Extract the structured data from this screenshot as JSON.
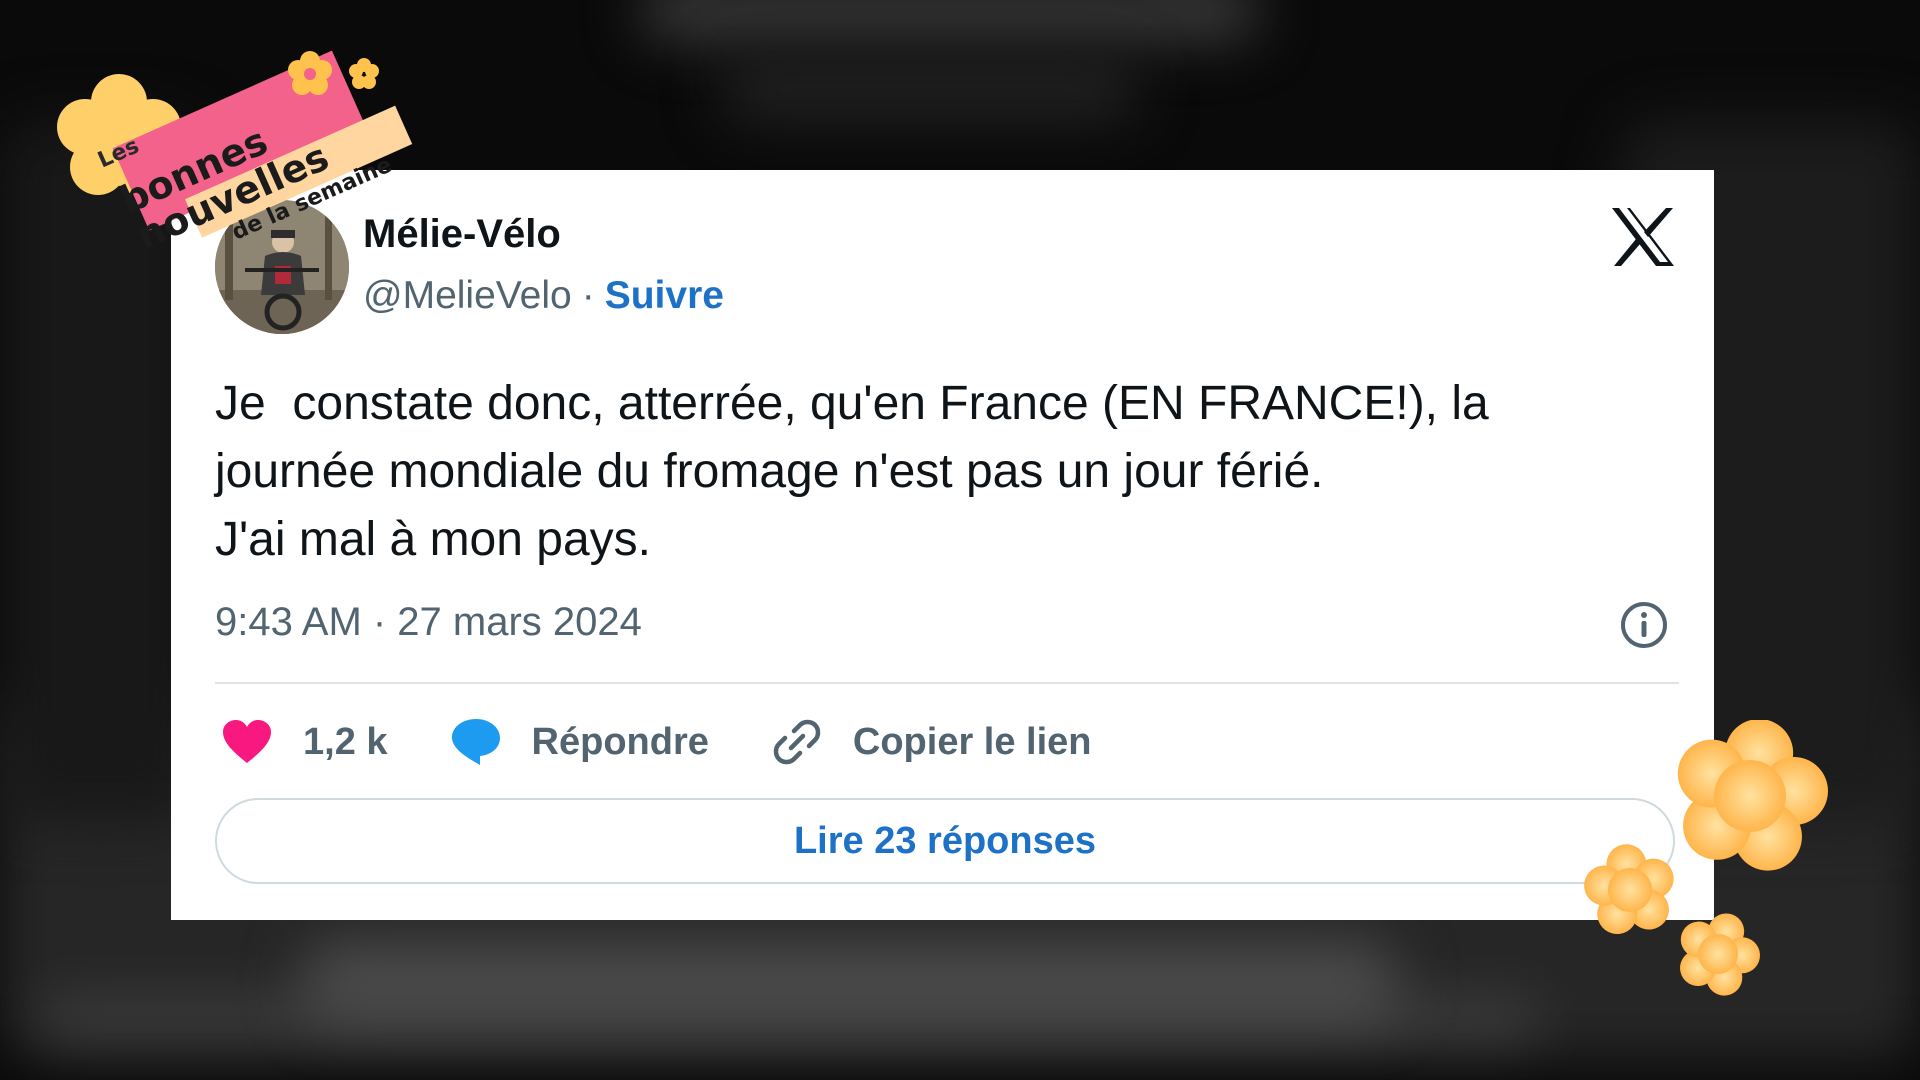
{
  "badge": {
    "line1": "Les",
    "line2": "bonnes",
    "line3": "nouvelles",
    "line4": "de la semaine"
  },
  "tweet": {
    "user_name": "Mélie-Vélo",
    "handle": "@MelieVelo",
    "separator": "·",
    "follow_label": "Suivre",
    "text_lines": [
      "Je  constate donc, atterrée, qu'en France (EN FRANCE!), la",
      "journée mondiale du fromage n'est pas un jour férié.",
      "J'ai mal à mon pays."
    ],
    "timestamp": "9:43 AM · 27 mars 2024",
    "actions": {
      "like_count": "1,2 k",
      "reply_label": "Répondre",
      "copy_label": "Copier le lien"
    },
    "replies_button": "Lire 23 réponses"
  },
  "icons": {
    "platform": "x-logo-icon",
    "like": "heart-icon",
    "reply": "speech-bubble-icon",
    "copy": "link-icon",
    "info": "info-icon"
  },
  "colors": {
    "like": "#f91880",
    "reply": "#1d9bf0",
    "link": "#1d72c7",
    "badge_pink": "#f2628b",
    "badge_peach": "#ffd6a0",
    "flower_orange": "#ffb74a"
  }
}
